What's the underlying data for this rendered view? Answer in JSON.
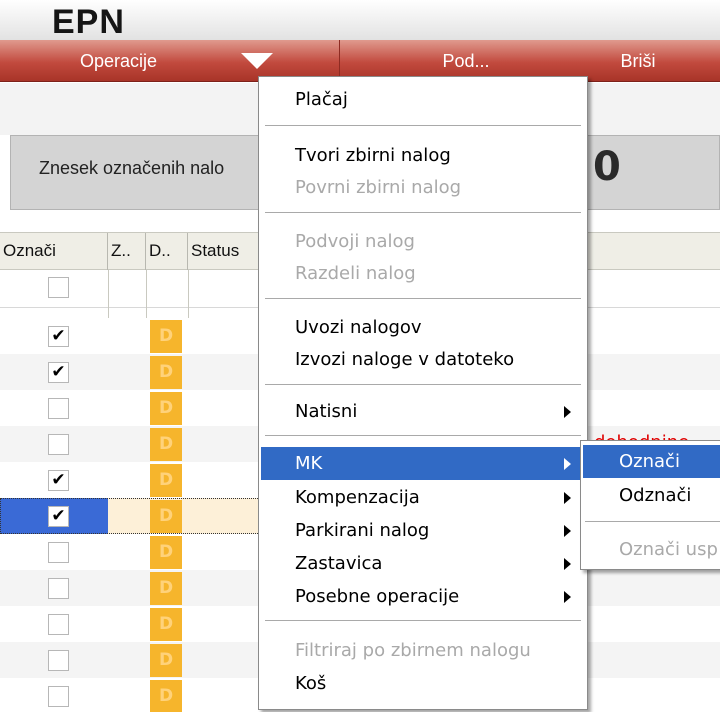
{
  "app": {
    "title": "EPN"
  },
  "toolbar": {
    "operations_label": "Operacije",
    "middle_label": "Pod...",
    "delete_label": "Briši"
  },
  "summary": {
    "label": "Znesek označenih nalo",
    "value": "0"
  },
  "grid": {
    "columns": [
      "Označi",
      "Z..",
      "D..",
      "Status"
    ],
    "rows": [
      {
        "checked": "✔",
        "badge": "D",
        "note": ""
      },
      {
        "checked": "✔",
        "badge": "D",
        "note": ""
      },
      {
        "checked": "",
        "badge": "D",
        "note": ""
      },
      {
        "checked": "",
        "badge": "D",
        "note": "dohodnine"
      },
      {
        "checked": "✔",
        "badge": "D",
        "note": ""
      },
      {
        "checked": "✔",
        "badge": "D",
        "note": ""
      },
      {
        "checked": "",
        "badge": "D",
        "note": ""
      },
      {
        "checked": "",
        "badge": "D",
        "note": ""
      },
      {
        "checked": "",
        "badge": "D",
        "note": ""
      },
      {
        "checked": "",
        "badge": "D",
        "note": ""
      },
      {
        "checked": "",
        "badge": "D",
        "note": ""
      }
    ]
  },
  "context_menu": {
    "items": [
      {
        "label": "Plačaj",
        "disabled": false
      },
      {
        "label": "Tvori zbirni nalog",
        "disabled": false
      },
      {
        "label": "Povrni zbirni nalog",
        "disabled": true
      },
      {
        "label": "Podvoji nalog",
        "disabled": true
      },
      {
        "label": "Razdeli nalog",
        "disabled": true
      },
      {
        "label": "Uvozi nalogov",
        "disabled": false
      },
      {
        "label": "Izvozi naloge v datoteko",
        "disabled": false
      },
      {
        "label": "Natisni",
        "disabled": false
      },
      {
        "label": "MK",
        "disabled": false
      },
      {
        "label": "Kompenzacija",
        "disabled": false
      },
      {
        "label": "Parkirani nalog",
        "disabled": false
      },
      {
        "label": "Zastavica",
        "disabled": false
      },
      {
        "label": "Posebne operacije",
        "disabled": false
      },
      {
        "label": "Filtriraj po zbirnem nalogu",
        "disabled": true
      },
      {
        "label": "Koš",
        "disabled": false
      }
    ]
  },
  "submenu": {
    "items": [
      {
        "label": "Označi"
      },
      {
        "label": "Odznači"
      },
      {
        "label": "Označi usp"
      }
    ]
  }
}
